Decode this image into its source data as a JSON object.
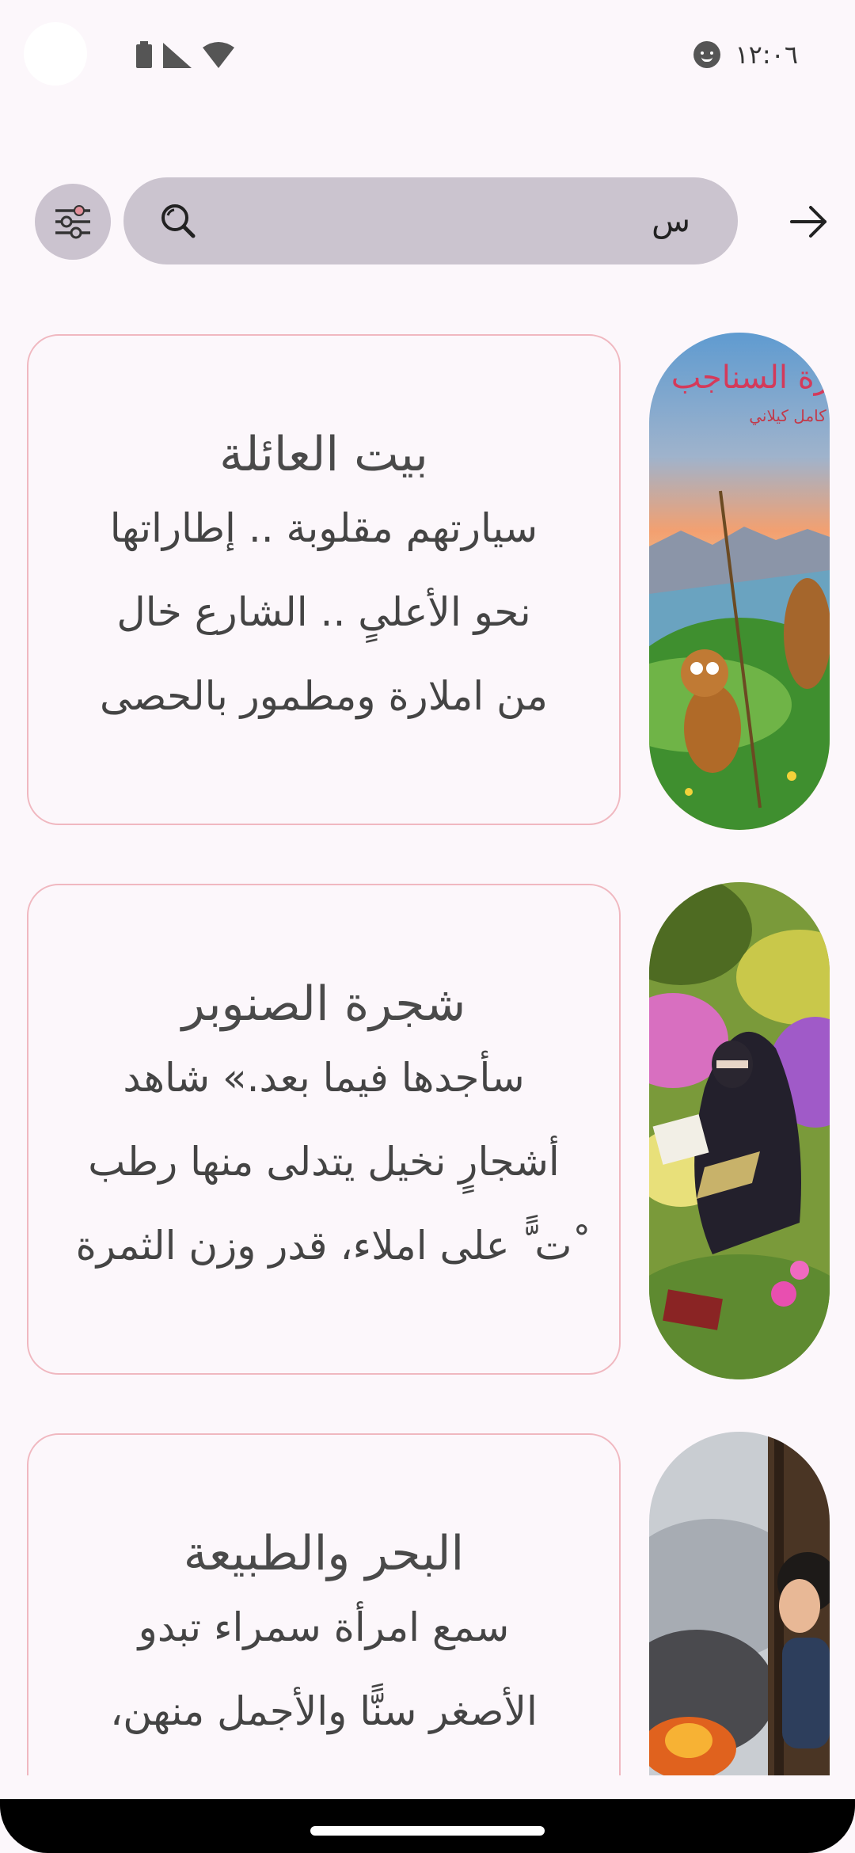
{
  "status": {
    "time": "١٢:٠٦",
    "icons": [
      "battery-icon",
      "signal-icon",
      "wifi-icon",
      "face-notification-icon"
    ]
  },
  "search": {
    "query": "س",
    "filter_icon": "sliders-icon",
    "search_icon": "search-icon",
    "back_icon": "arrow-forward-icon"
  },
  "stories": [
    {
      "title": "بيت العائلة",
      "excerpt": "سيارتهم مقلوبة .. إطاراتها\nنحو الأعلىٍ .. الشارع خال\nمن املارة ومطمور بالحصى",
      "thumb_text": [
        "رة السناجب",
        "كامل كيلاني"
      ]
    },
    {
      "title": "شجرة الصنوبر",
      "excerpt": "سأجدها فيما بعد.» شاهد\nأشجارٍ نخيل يتدلى منها رطب\nْت ًّ على املاء، قدر وزن الثمرة",
      "thumb_text": []
    },
    {
      "title": "البحر والطبيعة",
      "excerpt": "سمع امرأة سمراء تبدو\nالأصغر سنًّا والأجمل منهن،",
      "thumb_text": []
    }
  ],
  "colors": {
    "background": "#fcf7fb",
    "search_bg": "#cbc4cf",
    "card_border": "#f0b8c0",
    "text": "#444444"
  }
}
